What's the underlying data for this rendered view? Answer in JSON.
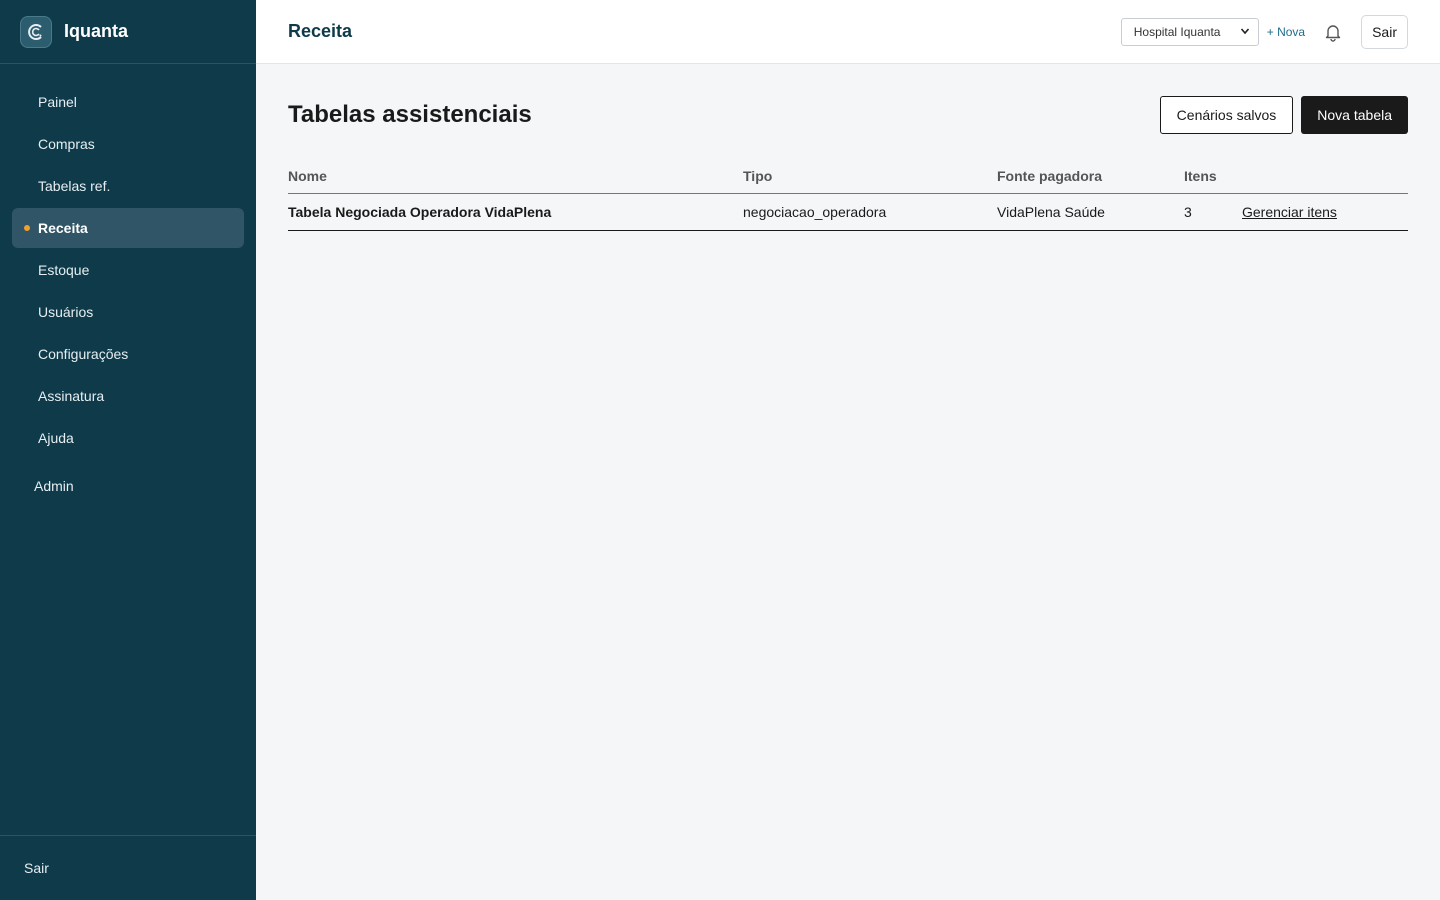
{
  "brand": {
    "name": "Iquanta"
  },
  "sidebar": {
    "items": [
      {
        "label": "Painel"
      },
      {
        "label": "Compras"
      },
      {
        "label": "Tabelas ref."
      },
      {
        "label": "Receita"
      },
      {
        "label": "Estoque"
      },
      {
        "label": "Usuários"
      },
      {
        "label": "Configurações"
      },
      {
        "label": "Assinatura"
      },
      {
        "label": "Ajuda"
      }
    ],
    "active_item": "Receita",
    "admin_label": "Admin",
    "logout_label": "Sair"
  },
  "header": {
    "title": "Receita",
    "hospital_selected": "Hospital Iquanta",
    "new_link": "+ Nova",
    "logout_label": "Sair"
  },
  "page": {
    "title": "Tabelas assistenciais",
    "saved_scenarios_label": "Cenários salvos",
    "new_table_label": "Nova tabela"
  },
  "table": {
    "columns": [
      "Nome",
      "Tipo",
      "Fonte pagadora",
      "Itens"
    ],
    "rows": [
      {
        "nome": "Tabela Negociada Operadora VidaPlena",
        "tipo": "negociacao_operadora",
        "fonte": "VidaPlena Saúde",
        "itens": "3",
        "action": "Gerenciar itens"
      }
    ]
  },
  "colors": {
    "sidebar_bg": "#0e3a4a",
    "active_item_bg": "#2f5566",
    "active_dot": "#f0a030",
    "link_accent": "#1f6c8c",
    "primary_button": "#1a1a1a",
    "page_bg": "#f4f6f8"
  }
}
